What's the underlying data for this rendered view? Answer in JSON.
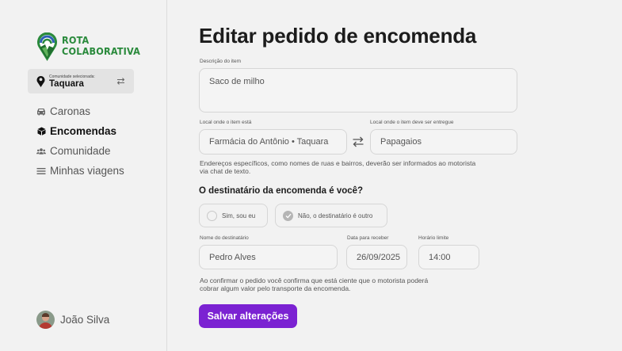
{
  "brand": {
    "line1": "ROTA",
    "line2": "COLABORATIVA",
    "color": "#2a8a3c"
  },
  "community": {
    "label": "Comunidade selecionada:",
    "name": "Taquara"
  },
  "nav": {
    "items": [
      {
        "label": "Caronas",
        "icon": "car-icon"
      },
      {
        "label": "Encomendas",
        "icon": "package-icon",
        "active": true
      },
      {
        "label": "Comunidade",
        "icon": "users-icon"
      },
      {
        "label": "Minhas viagens",
        "icon": "list-icon"
      }
    ]
  },
  "user": {
    "name": "João Silva"
  },
  "page": {
    "title": "Editar pedido de encomenda"
  },
  "form": {
    "description": {
      "label": "Descrição do item",
      "value": "Saco de milho"
    },
    "origin": {
      "label": "Local onde o item está",
      "value": "Farmácia do Antônio • Taquara"
    },
    "destination": {
      "label": "Local onde o item deve ser entregue",
      "value": "Papagaios"
    },
    "address_note_1": "Endereços específicos, como nomes de ruas e bairros, deverão ser informados ao motorista",
    "address_note_2": "via chat de texto.",
    "recipient_question": "O destinatário da encomenda é você?",
    "option_yes": "Sim, sou eu",
    "option_no": "Não, o destinatário é outro",
    "selected_option": "no",
    "recipient_name": {
      "label": "Nome do destinatário",
      "value": "Pedro Alves"
    },
    "date": {
      "label": "Data para receber",
      "value": "26/09/2025"
    },
    "time": {
      "label": "Horário limite",
      "value": "14:00"
    },
    "confirm_note_1": "Ao confirmar o pedido você confirma que está ciente que o motorista poderá",
    "confirm_note_2": "cobrar algum valor pelo transporte da encomenda.",
    "save_label": "Salvar alterações"
  },
  "colors": {
    "accent": "#7b22d2",
    "background": "#f2f2f2"
  }
}
